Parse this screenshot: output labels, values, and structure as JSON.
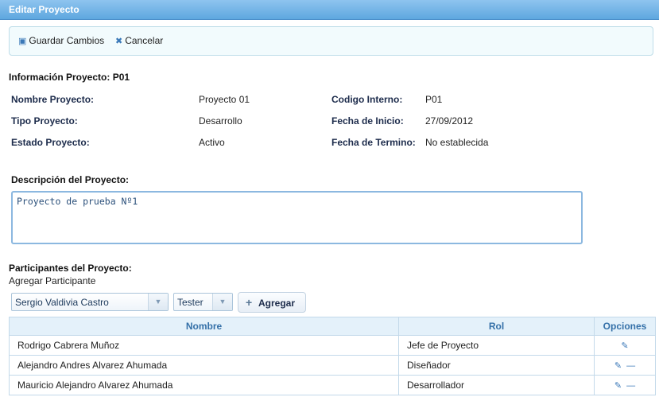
{
  "window": {
    "title": "Editar Proyecto"
  },
  "toolbar": {
    "save_label": "Guardar Cambios",
    "cancel_label": "Cancelar"
  },
  "info": {
    "heading": "Información Proyecto: P01",
    "nombre_label": "Nombre Proyecto:",
    "nombre_value": "Proyecto 01",
    "tipo_label": "Tipo Proyecto:",
    "tipo_value": "Desarrollo",
    "estado_label": "Estado Proyecto:",
    "estado_value": "Activo",
    "codigo_label": "Codigo Interno:",
    "codigo_value": "P01",
    "inicio_label": "Fecha de Inicio:",
    "inicio_value": "27/09/2012",
    "termino_label": "Fecha de Termino:",
    "termino_value": "No establecida"
  },
  "description": {
    "label": "Descripción del Proyecto:",
    "value": "Proyecto de prueba Nº1"
  },
  "participants": {
    "heading": "Participantes del Proyecto:",
    "add_label": "Agregar Participante",
    "selected_person": "Sergio Valdivia Castro",
    "selected_role": "Tester",
    "add_button": "Agregar",
    "columns": [
      "Nombre",
      "Rol",
      "Opciones"
    ],
    "rows": [
      {
        "nombre": "Rodrigo Cabrera Muñoz",
        "rol": "Jefe de Proyecto"
      },
      {
        "nombre": "Alejandro Andres Alvarez Ahumada",
        "rol": "Diseñador"
      },
      {
        "nombre": "Mauricio Alejandro Alvarez Ahumada",
        "rol": "Desarrollador"
      }
    ]
  },
  "icons": {
    "save": "floppy-disk-icon",
    "cancel": "x-icon",
    "edit": "pencil-icon",
    "remove": "minus-icon",
    "add": "plus-icon",
    "dropdown": "chevron-down-icon"
  },
  "colors": {
    "titlebar": "#5ea7df",
    "link": "#3a78b8",
    "label": "#1c2b4b",
    "header_bg": "#e4f1fa"
  }
}
